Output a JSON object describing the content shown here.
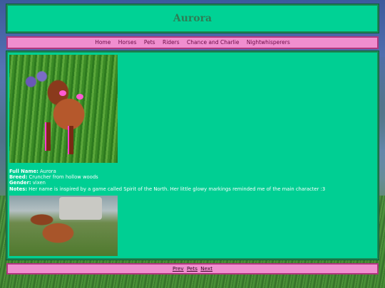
{
  "header": {
    "title": "Aurora"
  },
  "nav": {
    "items": [
      "Home",
      "Horses",
      "Pets",
      "Riders",
      "Chance and Charlie",
      "Nightwhisperers"
    ]
  },
  "profile": {
    "full_name_label": "Full Name:",
    "full_name": "Aurora",
    "breed_label": "Breed:",
    "breed": "Cruncher from hollow woods",
    "gender_label": "Gender:",
    "gender": "vixen",
    "notes_label": "Notes:",
    "notes": "Her name is inspired by a game called Spirit of the North. Her little glowy markings reminded me of the main character :3"
  },
  "footer": {
    "prev": "Prev",
    "pets": "Pets",
    "next": "Next"
  },
  "colors": {
    "panel": "#00d295",
    "nav": "#f08ecf",
    "text": "#ffffff"
  }
}
